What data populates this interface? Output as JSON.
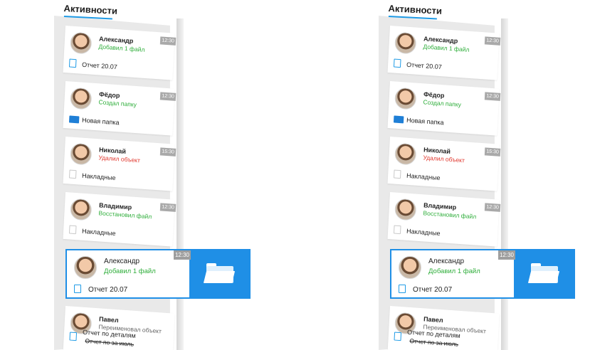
{
  "title": "Активности",
  "panels": [
    {
      "activities": [
        {
          "name": "Александр",
          "action": "Добавил 1 файл",
          "action_color": "green",
          "time": "12:30",
          "file": "Отчет 20.07",
          "file_icon": "document-icon"
        },
        {
          "name": "Фёдор",
          "action": "Создал папку",
          "action_color": "green",
          "time": "12:30",
          "file": "Новая папка",
          "file_icon": "folder-icon"
        },
        {
          "name": "Николай",
          "action": "Удалил объект",
          "action_color": "red",
          "time": "15:30",
          "file": "Накладные",
          "file_icon": "document-gray-icon"
        },
        {
          "name": "Владимир",
          "action": "Восстановил файл",
          "action_color": "green",
          "time": "12:30",
          "file": "Накладные",
          "file_icon": "document-gray-icon"
        },
        {
          "name": "Павел",
          "action": "Переименовал объект",
          "action_color": "gray",
          "time": "",
          "file": "Отчет по деталям",
          "file_old": "Отчет по за июль",
          "file_icon": "document-icon"
        }
      ],
      "active": {
        "name": "Александр",
        "action": "Добавил 1 файл",
        "time": "12:30",
        "file": "Отчет 20.07"
      }
    },
    {
      "activities": [
        {
          "name": "Александр",
          "action": "Добавил 1 файл",
          "action_color": "green",
          "time": "12:30",
          "file": "Отчет 20.07",
          "file_icon": "document-icon"
        },
        {
          "name": "Фёдор",
          "action": "Создал папку",
          "action_color": "green",
          "time": "12:30",
          "file": "Новая папка",
          "file_icon": "folder-icon"
        },
        {
          "name": "Николай",
          "action": "Удалил объект",
          "action_color": "red",
          "time": "15:30",
          "file": "Накладные",
          "file_icon": "document-gray-icon"
        },
        {
          "name": "Владимир",
          "action": "Восстановил файл",
          "action_color": "green",
          "time": "12:30",
          "file": "Накладные",
          "file_icon": "document-gray-icon"
        },
        {
          "name": "Павел",
          "action": "Переименовал объект",
          "action_color": "gray",
          "time": "",
          "file": "Отчет по деталям",
          "file_old": "Отчет по за июль",
          "file_icon": "document-icon"
        }
      ],
      "active": {
        "name": "Александр",
        "action": "Добавил 1 файл",
        "time": "12:30",
        "file": "Отчет 20.07"
      }
    }
  ],
  "colors": {
    "accent": "#1f8fe6",
    "green": "#2fae3b",
    "red": "#e0352b",
    "time_badge": "#a9a9a9"
  }
}
